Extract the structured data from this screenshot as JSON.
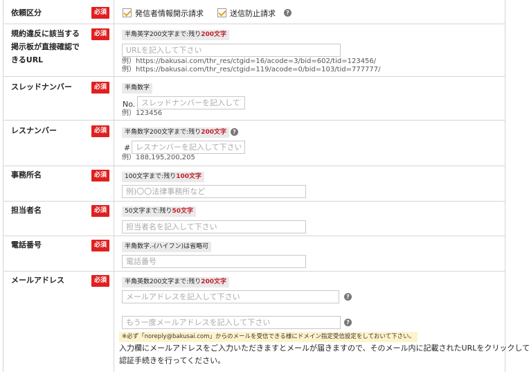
{
  "request_type": {
    "label": "依頼区分",
    "required": "必須",
    "option1": "発信者情報開示請求",
    "option2": "送信防止請求",
    "help": "?"
  },
  "url_field": {
    "label": "規約違反に該当する掲示板が直接確認できるURL",
    "required": "必須",
    "hint_prefix": "半角英字200文字まで:残り",
    "hint_count": "200文字",
    "placeholder": "URLを記入して下さい",
    "example1": "例）https://bakusai.com/thr_res/ctgid=16/acode=3/bid=602/tid=123456/",
    "example2": "例）https://bakusai.com/thr_res/ctgid=119/acode=0/bid=103/tid=777777/"
  },
  "thread_number": {
    "label": "スレッドナンバー",
    "required": "必須",
    "hint": "半角数字",
    "prefix": "No.",
    "placeholder": "スレッドナンバーを記入して下さい",
    "example": "例）123456"
  },
  "res_number": {
    "label": "レスナンバー",
    "required": "必須",
    "hint_prefix": "半角数字200文字まで:残り",
    "hint_count": "200文字",
    "help": "?",
    "prefix": "#",
    "placeholder": "レスナンバーを記入して下さい",
    "example": "例）188,195,200,205"
  },
  "office_name": {
    "label": "事務所名",
    "required": "必須",
    "hint_prefix": "100文字まで:残り",
    "hint_count": "100文字",
    "placeholder": "例)〇〇法律事務所など"
  },
  "person_name": {
    "label": "担当者名",
    "required": "必須",
    "hint_prefix": "50文字まで:残り",
    "hint_count": "50文字",
    "placeholder": "担当者名を記入して下さい"
  },
  "phone": {
    "label": "電話番号",
    "required": "必須",
    "hint": "半角数字.-(ハイフン)は省略可",
    "placeholder": "電話番号"
  },
  "email": {
    "label": "メールアドレス",
    "required": "必須",
    "hint_prefix": "半角英数200文字まで:残り",
    "hint_count": "200文字",
    "placeholder1": "メールアドレスを記入して下さい",
    "placeholder2": "もう一度メールアドレスを記入して下さい",
    "help": "?",
    "notice": "※必ず「noreply@bakusai.com」からのメールを受信できる様にドメイン指定受信設定をしておいて下さい。",
    "note_line1": "入力欄にメールアドレスをご入力いただきますとメールが届きますので、そのメール内に記載されたURLをクリックして",
    "note_line2": "認証手続きを行ってください。"
  }
}
